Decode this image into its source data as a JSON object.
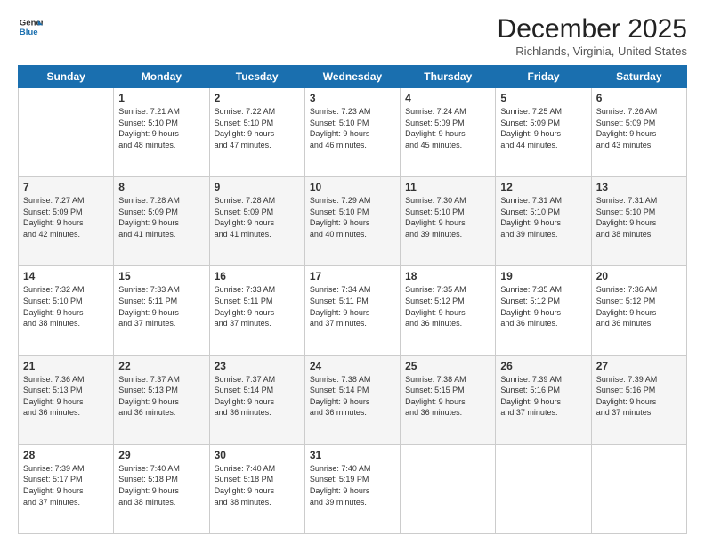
{
  "header": {
    "logo": {
      "general": "General",
      "blue": "Blue"
    },
    "title": "December 2025",
    "location": "Richlands, Virginia, United States"
  },
  "days_of_week": [
    "Sunday",
    "Monday",
    "Tuesday",
    "Wednesday",
    "Thursday",
    "Friday",
    "Saturday"
  ],
  "weeks": [
    [
      {
        "day": "",
        "info": ""
      },
      {
        "day": "1",
        "info": "Sunrise: 7:21 AM\nSunset: 5:10 PM\nDaylight: 9 hours\nand 48 minutes."
      },
      {
        "day": "2",
        "info": "Sunrise: 7:22 AM\nSunset: 5:10 PM\nDaylight: 9 hours\nand 47 minutes."
      },
      {
        "day": "3",
        "info": "Sunrise: 7:23 AM\nSunset: 5:10 PM\nDaylight: 9 hours\nand 46 minutes."
      },
      {
        "day": "4",
        "info": "Sunrise: 7:24 AM\nSunset: 5:09 PM\nDaylight: 9 hours\nand 45 minutes."
      },
      {
        "day": "5",
        "info": "Sunrise: 7:25 AM\nSunset: 5:09 PM\nDaylight: 9 hours\nand 44 minutes."
      },
      {
        "day": "6",
        "info": "Sunrise: 7:26 AM\nSunset: 5:09 PM\nDaylight: 9 hours\nand 43 minutes."
      }
    ],
    [
      {
        "day": "7",
        "info": "Sunrise: 7:27 AM\nSunset: 5:09 PM\nDaylight: 9 hours\nand 42 minutes."
      },
      {
        "day": "8",
        "info": "Sunrise: 7:28 AM\nSunset: 5:09 PM\nDaylight: 9 hours\nand 41 minutes."
      },
      {
        "day": "9",
        "info": "Sunrise: 7:28 AM\nSunset: 5:09 PM\nDaylight: 9 hours\nand 41 minutes."
      },
      {
        "day": "10",
        "info": "Sunrise: 7:29 AM\nSunset: 5:10 PM\nDaylight: 9 hours\nand 40 minutes."
      },
      {
        "day": "11",
        "info": "Sunrise: 7:30 AM\nSunset: 5:10 PM\nDaylight: 9 hours\nand 39 minutes."
      },
      {
        "day": "12",
        "info": "Sunrise: 7:31 AM\nSunset: 5:10 PM\nDaylight: 9 hours\nand 39 minutes."
      },
      {
        "day": "13",
        "info": "Sunrise: 7:31 AM\nSunset: 5:10 PM\nDaylight: 9 hours\nand 38 minutes."
      }
    ],
    [
      {
        "day": "14",
        "info": "Sunrise: 7:32 AM\nSunset: 5:10 PM\nDaylight: 9 hours\nand 38 minutes."
      },
      {
        "day": "15",
        "info": "Sunrise: 7:33 AM\nSunset: 5:11 PM\nDaylight: 9 hours\nand 37 minutes."
      },
      {
        "day": "16",
        "info": "Sunrise: 7:33 AM\nSunset: 5:11 PM\nDaylight: 9 hours\nand 37 minutes."
      },
      {
        "day": "17",
        "info": "Sunrise: 7:34 AM\nSunset: 5:11 PM\nDaylight: 9 hours\nand 37 minutes."
      },
      {
        "day": "18",
        "info": "Sunrise: 7:35 AM\nSunset: 5:12 PM\nDaylight: 9 hours\nand 36 minutes."
      },
      {
        "day": "19",
        "info": "Sunrise: 7:35 AM\nSunset: 5:12 PM\nDaylight: 9 hours\nand 36 minutes."
      },
      {
        "day": "20",
        "info": "Sunrise: 7:36 AM\nSunset: 5:12 PM\nDaylight: 9 hours\nand 36 minutes."
      }
    ],
    [
      {
        "day": "21",
        "info": "Sunrise: 7:36 AM\nSunset: 5:13 PM\nDaylight: 9 hours\nand 36 minutes."
      },
      {
        "day": "22",
        "info": "Sunrise: 7:37 AM\nSunset: 5:13 PM\nDaylight: 9 hours\nand 36 minutes."
      },
      {
        "day": "23",
        "info": "Sunrise: 7:37 AM\nSunset: 5:14 PM\nDaylight: 9 hours\nand 36 minutes."
      },
      {
        "day": "24",
        "info": "Sunrise: 7:38 AM\nSunset: 5:14 PM\nDaylight: 9 hours\nand 36 minutes."
      },
      {
        "day": "25",
        "info": "Sunrise: 7:38 AM\nSunset: 5:15 PM\nDaylight: 9 hours\nand 36 minutes."
      },
      {
        "day": "26",
        "info": "Sunrise: 7:39 AM\nSunset: 5:16 PM\nDaylight: 9 hours\nand 37 minutes."
      },
      {
        "day": "27",
        "info": "Sunrise: 7:39 AM\nSunset: 5:16 PM\nDaylight: 9 hours\nand 37 minutes."
      }
    ],
    [
      {
        "day": "28",
        "info": "Sunrise: 7:39 AM\nSunset: 5:17 PM\nDaylight: 9 hours\nand 37 minutes."
      },
      {
        "day": "29",
        "info": "Sunrise: 7:40 AM\nSunset: 5:18 PM\nDaylight: 9 hours\nand 38 minutes."
      },
      {
        "day": "30",
        "info": "Sunrise: 7:40 AM\nSunset: 5:18 PM\nDaylight: 9 hours\nand 38 minutes."
      },
      {
        "day": "31",
        "info": "Sunrise: 7:40 AM\nSunset: 5:19 PM\nDaylight: 9 hours\nand 39 minutes."
      },
      {
        "day": "",
        "info": ""
      },
      {
        "day": "",
        "info": ""
      },
      {
        "day": "",
        "info": ""
      }
    ]
  ]
}
